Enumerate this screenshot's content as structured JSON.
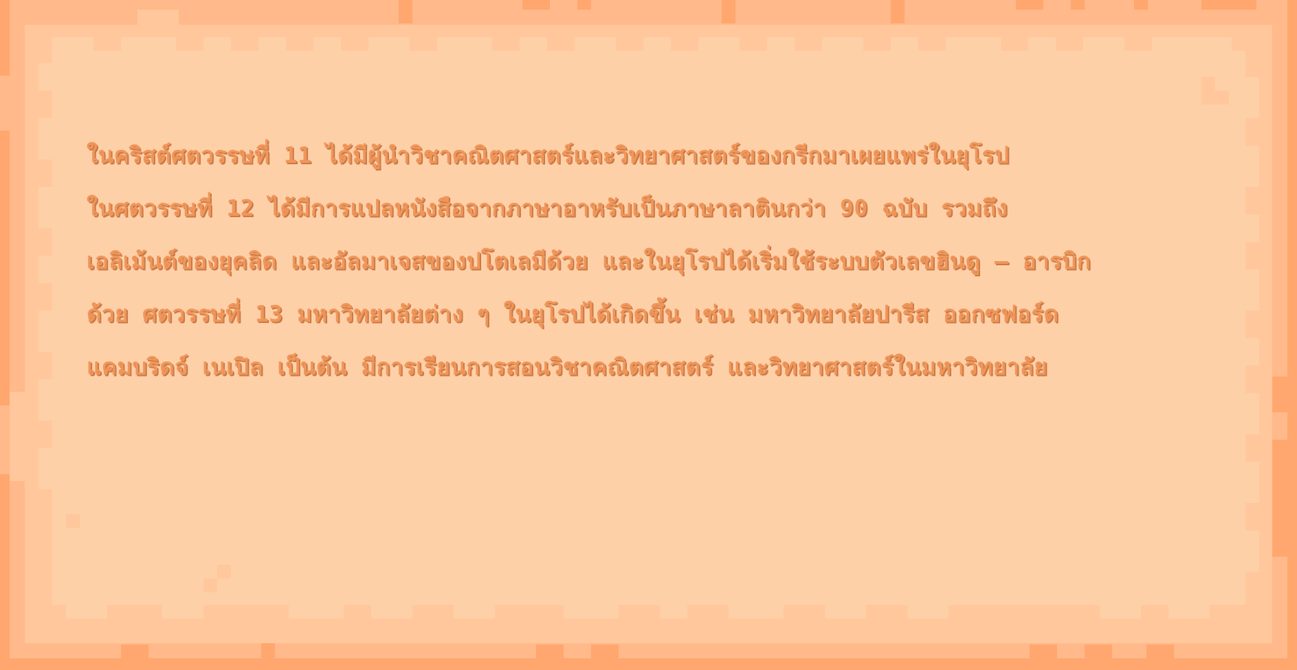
{
  "dialog": {
    "lines": [
      "ในคริสต์ศตวรรษที่ 11 ได้มีผู้นำวิชาคณิตศาสตร์และวิทยาศาสตร์ของกรีกมาเผยแพร่ในยุโรป",
      "ในศตวรรษที่ 12 ได้มีการแปลหนังสือจากภาษาอาหรับเป็นภาษาลาตินกว่า 90 ฉบับ รวมถึง",
      "เอลิเม้นต์ของยุคลิด และอัลมาเจสของปโตเลมีด้วย และในยุโรปได้เริ่มใช้ระบบตัวเลขฮินดู – อารบิก",
      "ด้วย ศตวรรษที่ 13 มหาวิทยาลัยต่าง ๆ ในยุโรปได้เกิดขึ้น เช่น มหาวิทยาลัยปารีส ออกซฟอร์ด",
      "แคมบริดจ์ เนเปิล เป็นต้น มีการเรียนการสอนวิชาคณิตศาสตร์ และวิทยาศาสตร์ในมหาวิทยาลัย"
    ]
  },
  "colors": {
    "outer": "#ffb98a",
    "mid": "#ffc79b",
    "inner": "#fed0a8",
    "dark": "#ffa76e",
    "text": "#f0965a",
    "text_shadow": "#c97a47"
  }
}
